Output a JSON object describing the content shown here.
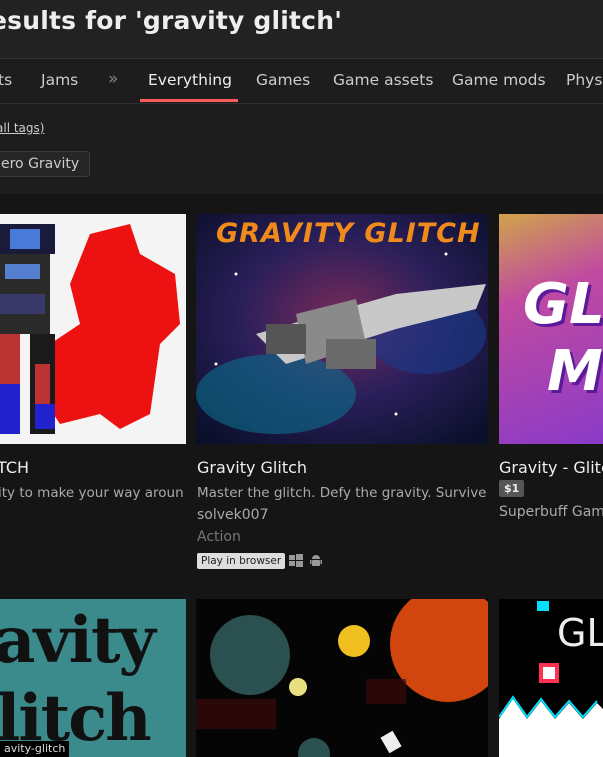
{
  "header": {
    "title": "esults for 'gravity glitch'"
  },
  "tabs": [
    {
      "label": "ts"
    },
    {
      "label": "Jams"
    },
    {
      "label": "»"
    },
    {
      "label": "Everything"
    },
    {
      "label": "Games"
    },
    {
      "label": "Game assets"
    },
    {
      "label": "Game mods"
    },
    {
      "label": "Phys"
    }
  ],
  "filters": {
    "all_tags": "all tags)",
    "tag": "ero Gravity"
  },
  "results": [
    {
      "title": "TCH",
      "description": "ity to make your way aroun..."
    },
    {
      "title": "Gravity Glitch",
      "description": "Master the glitch. Defy the gravity. Survive ...",
      "author": "solvek007",
      "genre": "Action",
      "badge": "Play in browser",
      "thumb_text": "GRAVITY GLITCH"
    },
    {
      "title": "Gravity - Glitc",
      "price": "$1",
      "author": "Superbuff Game",
      "thumb_text_1": "GL",
      "thumb_text_2": "M"
    },
    {
      "thumb_text_1": "avity",
      "thumb_text_2": "litch",
      "caption": "avity-glitch"
    },
    {},
    {
      "thumb_text": "GL"
    }
  ],
  "colors": {
    "accent": "#fa5c5c",
    "background": "#1d1d1d"
  },
  "icons": [
    "windows-icon",
    "android-icon"
  ]
}
